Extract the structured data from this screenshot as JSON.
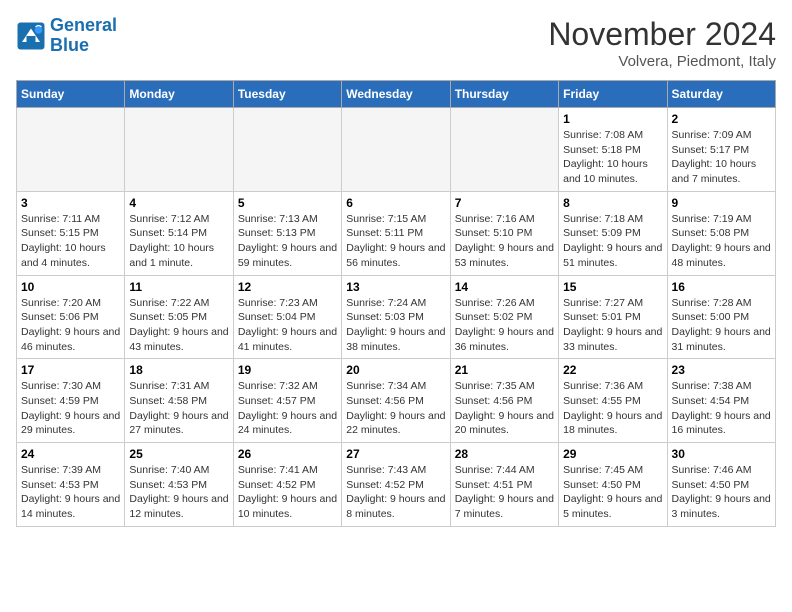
{
  "header": {
    "logo_line1": "General",
    "logo_line2": "Blue",
    "month": "November 2024",
    "location": "Volvera, Piedmont, Italy"
  },
  "weekdays": [
    "Sunday",
    "Monday",
    "Tuesday",
    "Wednesday",
    "Thursday",
    "Friday",
    "Saturday"
  ],
  "weeks": [
    [
      {
        "day": "",
        "info": ""
      },
      {
        "day": "",
        "info": ""
      },
      {
        "day": "",
        "info": ""
      },
      {
        "day": "",
        "info": ""
      },
      {
        "day": "",
        "info": ""
      },
      {
        "day": "1",
        "info": "Sunrise: 7:08 AM\nSunset: 5:18 PM\nDaylight: 10 hours and 10 minutes."
      },
      {
        "day": "2",
        "info": "Sunrise: 7:09 AM\nSunset: 5:17 PM\nDaylight: 10 hours and 7 minutes."
      }
    ],
    [
      {
        "day": "3",
        "info": "Sunrise: 7:11 AM\nSunset: 5:15 PM\nDaylight: 10 hours and 4 minutes."
      },
      {
        "day": "4",
        "info": "Sunrise: 7:12 AM\nSunset: 5:14 PM\nDaylight: 10 hours and 1 minute."
      },
      {
        "day": "5",
        "info": "Sunrise: 7:13 AM\nSunset: 5:13 PM\nDaylight: 9 hours and 59 minutes."
      },
      {
        "day": "6",
        "info": "Sunrise: 7:15 AM\nSunset: 5:11 PM\nDaylight: 9 hours and 56 minutes."
      },
      {
        "day": "7",
        "info": "Sunrise: 7:16 AM\nSunset: 5:10 PM\nDaylight: 9 hours and 53 minutes."
      },
      {
        "day": "8",
        "info": "Sunrise: 7:18 AM\nSunset: 5:09 PM\nDaylight: 9 hours and 51 minutes."
      },
      {
        "day": "9",
        "info": "Sunrise: 7:19 AM\nSunset: 5:08 PM\nDaylight: 9 hours and 48 minutes."
      }
    ],
    [
      {
        "day": "10",
        "info": "Sunrise: 7:20 AM\nSunset: 5:06 PM\nDaylight: 9 hours and 46 minutes."
      },
      {
        "day": "11",
        "info": "Sunrise: 7:22 AM\nSunset: 5:05 PM\nDaylight: 9 hours and 43 minutes."
      },
      {
        "day": "12",
        "info": "Sunrise: 7:23 AM\nSunset: 5:04 PM\nDaylight: 9 hours and 41 minutes."
      },
      {
        "day": "13",
        "info": "Sunrise: 7:24 AM\nSunset: 5:03 PM\nDaylight: 9 hours and 38 minutes."
      },
      {
        "day": "14",
        "info": "Sunrise: 7:26 AM\nSunset: 5:02 PM\nDaylight: 9 hours and 36 minutes."
      },
      {
        "day": "15",
        "info": "Sunrise: 7:27 AM\nSunset: 5:01 PM\nDaylight: 9 hours and 33 minutes."
      },
      {
        "day": "16",
        "info": "Sunrise: 7:28 AM\nSunset: 5:00 PM\nDaylight: 9 hours and 31 minutes."
      }
    ],
    [
      {
        "day": "17",
        "info": "Sunrise: 7:30 AM\nSunset: 4:59 PM\nDaylight: 9 hours and 29 minutes."
      },
      {
        "day": "18",
        "info": "Sunrise: 7:31 AM\nSunset: 4:58 PM\nDaylight: 9 hours and 27 minutes."
      },
      {
        "day": "19",
        "info": "Sunrise: 7:32 AM\nSunset: 4:57 PM\nDaylight: 9 hours and 24 minutes."
      },
      {
        "day": "20",
        "info": "Sunrise: 7:34 AM\nSunset: 4:56 PM\nDaylight: 9 hours and 22 minutes."
      },
      {
        "day": "21",
        "info": "Sunrise: 7:35 AM\nSunset: 4:56 PM\nDaylight: 9 hours and 20 minutes."
      },
      {
        "day": "22",
        "info": "Sunrise: 7:36 AM\nSunset: 4:55 PM\nDaylight: 9 hours and 18 minutes."
      },
      {
        "day": "23",
        "info": "Sunrise: 7:38 AM\nSunset: 4:54 PM\nDaylight: 9 hours and 16 minutes."
      }
    ],
    [
      {
        "day": "24",
        "info": "Sunrise: 7:39 AM\nSunset: 4:53 PM\nDaylight: 9 hours and 14 minutes."
      },
      {
        "day": "25",
        "info": "Sunrise: 7:40 AM\nSunset: 4:53 PM\nDaylight: 9 hours and 12 minutes."
      },
      {
        "day": "26",
        "info": "Sunrise: 7:41 AM\nSunset: 4:52 PM\nDaylight: 9 hours and 10 minutes."
      },
      {
        "day": "27",
        "info": "Sunrise: 7:43 AM\nSunset: 4:52 PM\nDaylight: 9 hours and 8 minutes."
      },
      {
        "day": "28",
        "info": "Sunrise: 7:44 AM\nSunset: 4:51 PM\nDaylight: 9 hours and 7 minutes."
      },
      {
        "day": "29",
        "info": "Sunrise: 7:45 AM\nSunset: 4:50 PM\nDaylight: 9 hours and 5 minutes."
      },
      {
        "day": "30",
        "info": "Sunrise: 7:46 AM\nSunset: 4:50 PM\nDaylight: 9 hours and 3 minutes."
      }
    ]
  ]
}
